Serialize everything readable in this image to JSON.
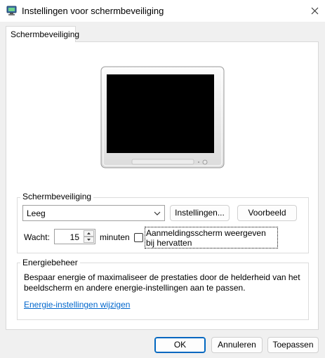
{
  "window": {
    "title": "Instellingen voor schermbeveiliging",
    "icon": "screensaver-app-icon",
    "close_icon": "close-icon"
  },
  "tab": {
    "label": "Schermbeveiliging"
  },
  "preview": {
    "icon": "monitor-preview"
  },
  "screensaver": {
    "group_label": "Schermbeveiliging",
    "selected": "Leeg",
    "settings_button": "Instellingen...",
    "preview_button": "Voorbeeld",
    "wait_label": "Wacht:",
    "wait_value": "15",
    "minutes_label": "minuten",
    "resume_checkbox_label": "Aanmeldingsscherm weergeven bij hervatten",
    "resume_checked": false
  },
  "power": {
    "group_label": "Energiebeheer",
    "description": "Bespaar energie of maximaliseer de prestaties door de helderheid van het beeldscherm en andere energie-instellingen aan te passen.",
    "link": "Energie-instellingen wijzigen"
  },
  "footer": {
    "ok": "OK",
    "cancel": "Annuleren",
    "apply": "Toepassen"
  }
}
